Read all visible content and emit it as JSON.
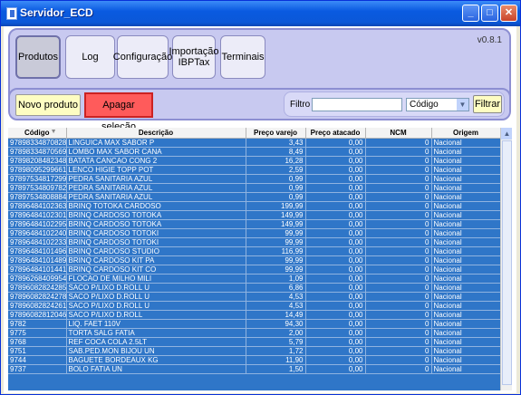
{
  "window": {
    "title": "Servidor_ECD"
  },
  "titlebar_buttons": {
    "minimize": "_",
    "maximize": "□",
    "close": "✕"
  },
  "nav": {
    "produtos": "Produtos",
    "log": "Log",
    "configuracao": "Configuração",
    "importacao_line1": "Importação",
    "importacao_line2": "IBPTax",
    "terminais": "Terminais"
  },
  "version": "v0.8.1",
  "actions": {
    "novo": "Novo produto",
    "apagar": "Apagar seleção"
  },
  "filter": {
    "label": "Filtro",
    "value": "",
    "field": "Código",
    "button": "Filtrar"
  },
  "table": {
    "headers": [
      "Código",
      "Descrição",
      "Preço varejo",
      "Preço atacado",
      "NCM",
      "Origem"
    ],
    "rows": [
      [
        "97898334870828",
        "LINGUICA MAX SABOR P",
        "3,43",
        "0,00",
        "0",
        "Nacional"
      ],
      [
        "97898334870569",
        "LOMBO MAX SABOR CANA",
        "8,49",
        "0,00",
        "0",
        "Nacional"
      ],
      [
        "97898208482348",
        "BATATA CANCAO CONG 2",
        "16,28",
        "0,00",
        "0",
        "Nacional"
      ],
      [
        "97898095299661",
        "LENCO HIGIE TOPP POT",
        "2,59",
        "0,00",
        "0",
        "Nacional"
      ],
      [
        "97897534817299",
        "PEDRA SANITARIA AZUL",
        "0,99",
        "0,00",
        "0",
        "Nacional"
      ],
      [
        "97897534809782",
        "PEDRA SANITARIA AZUL",
        "0,99",
        "0,00",
        "0",
        "Nacional"
      ],
      [
        "97897534808884",
        "PEDRA SANITARIA AZUL",
        "0,99",
        "0,00",
        "0",
        "Nacional"
      ],
      [
        "97896484102363",
        "BRINQ TOTOKA CARDOSO",
        "199,99",
        "0,00",
        "0",
        "Nacional"
      ],
      [
        "97896484102301",
        "BRINQ CARDOSO TOTOKA",
        "149,99",
        "0,00",
        "0",
        "Nacional"
      ],
      [
        "97896484102295",
        "BRINQ CARDOSO TOTOKA",
        "149,99",
        "0,00",
        "0",
        "Nacional"
      ],
      [
        "97896484102240",
        "BRINQ CARDOSO TOTOKI",
        "99,99",
        "0,00",
        "0",
        "Nacional"
      ],
      [
        "97896484102233",
        "BRINQ CARDOSO TOTOKI",
        "99,99",
        "0,00",
        "0",
        "Nacional"
      ],
      [
        "97896484101496",
        "BRINQ CARDOSO STUDIO",
        "116,99",
        "0,00",
        "0",
        "Nacional"
      ],
      [
        "97896484101489",
        "BRINQ CARDOSO KIT PA",
        "99,99",
        "0,00",
        "0",
        "Nacional"
      ],
      [
        "97896484101441",
        "BRINQ CARDOSO KIT CO",
        "99,99",
        "0,00",
        "0",
        "Nacional"
      ],
      [
        "97896268409954",
        "FLOCAO DE MILHO MILI",
        "1,09",
        "0,00",
        "0",
        "Nacional"
      ],
      [
        "97896082824285",
        "SACO P/LIXO D.ROLL U",
        "6,86",
        "0,00",
        "0",
        "Nacional"
      ],
      [
        "97896082824278",
        "SACO P/LIXO D.ROLL U",
        "4,53",
        "0,00",
        "0",
        "Nacional"
      ],
      [
        "97896082824261",
        "SACO P/LIXO D.ROLL U",
        "4,53",
        "0,00",
        "0",
        "Nacional"
      ],
      [
        "97896082812046",
        "SACO P/LIXO D.ROLL",
        "14,49",
        "0,00",
        "0",
        "Nacional"
      ],
      [
        "9782",
        "LIQ. FAET 110V",
        "94,30",
        "0,00",
        "0",
        "Nacional"
      ],
      [
        "9775",
        "TORTA SALG FATIA",
        "2,00",
        "0,00",
        "0",
        "Nacional"
      ],
      [
        "9768",
        "REF COCA COLA 2.5LT",
        "5,79",
        "0,00",
        "0",
        "Nacional"
      ],
      [
        "9751",
        "SAB.PED.MON BIJOU UN",
        "1,72",
        "0,00",
        "0",
        "Nacional"
      ],
      [
        "9744",
        "BAGUETE BORDEAUX KG",
        "11,90",
        "0,00",
        "0",
        "Nacional"
      ],
      [
        "9737",
        "BOLO FATIA UN",
        "1,50",
        "0,00",
        "0",
        "Nacional"
      ]
    ]
  }
}
